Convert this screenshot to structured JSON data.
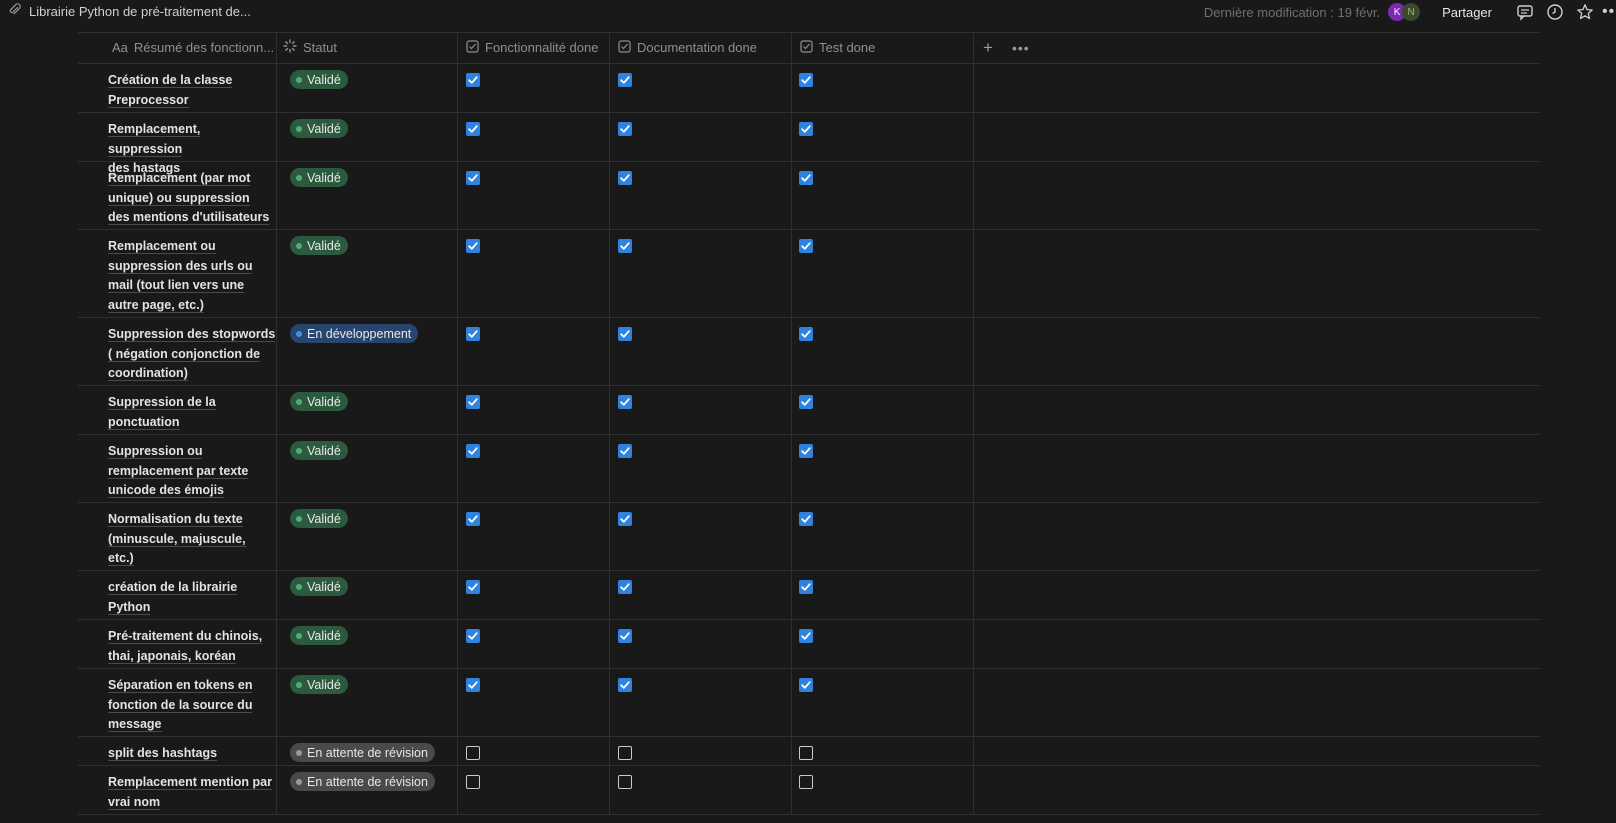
{
  "topbar": {
    "page_title": "Librairie Python de pré-traitement de...",
    "last_modified": "Dernière modification : 19 févr.",
    "avatars": [
      "K",
      "N"
    ],
    "share_label": "Partager"
  },
  "table": {
    "columns": [
      {
        "icon": "Aa",
        "label": "Résumé des fonctionn..."
      },
      {
        "label": "Statut"
      },
      {
        "label": "Fonctionnalité done"
      },
      {
        "label": "Documentation done"
      },
      {
        "label": "Test done"
      }
    ],
    "rows": [
      {
        "name": [
          "Création de la classe",
          "Preprocessor"
        ],
        "status": "Validé",
        "status_color": "green",
        "func": true,
        "doc": true,
        "test": true
      },
      {
        "name": [
          "Remplacement, suppression",
          "des hastags"
        ],
        "status": "Validé",
        "status_color": "green",
        "func": true,
        "doc": true,
        "test": true
      },
      {
        "name": [
          "Remplacement (par mot",
          "unique) ou  suppression",
          "des mentions d'utilisateurs"
        ],
        "status": "Validé",
        "status_color": "green",
        "func": true,
        "doc": true,
        "test": true
      },
      {
        "name": [
          "Remplacement ou",
          "suppression des urls ou",
          "mail (tout lien vers une",
          "autre page, etc.)"
        ],
        "status": "Validé",
        "status_color": "green",
        "func": true,
        "doc": true,
        "test": true
      },
      {
        "name": [
          "Suppression des stopwords",
          "( négation conjonction de",
          "coordination)"
        ],
        "status": "En développement",
        "status_color": "blue",
        "func": true,
        "doc": true,
        "test": true
      },
      {
        "name": [
          "Suppression de la",
          "ponctuation"
        ],
        "status": "Validé",
        "status_color": "green",
        "func": true,
        "doc": true,
        "test": true
      },
      {
        "name": [
          "Suppression ou",
          "remplacement par texte",
          "unicode des émojis"
        ],
        "status": "Validé",
        "status_color": "green",
        "func": true,
        "doc": true,
        "test": true
      },
      {
        "name": [
          "Normalisation du texte",
          "(minuscule, majuscule,",
          "etc.)"
        ],
        "status": "Validé",
        "status_color": "green",
        "func": true,
        "doc": true,
        "test": true
      },
      {
        "name": [
          "création de la librairie",
          "Python"
        ],
        "status": "Validé",
        "status_color": "green",
        "func": true,
        "doc": true,
        "test": true
      },
      {
        "name": [
          "Pré-traitement du chinois,",
          "thai, japonais, koréan"
        ],
        "status": "Validé",
        "status_color": "green",
        "func": true,
        "doc": true,
        "test": true
      },
      {
        "name": [
          "Séparation en tokens en",
          "fonction de la source du",
          "message"
        ],
        "status": "Validé",
        "status_color": "green",
        "func": true,
        "doc": true,
        "test": true
      },
      {
        "name": [
          "split des hashtags"
        ],
        "status": "En attente de révision",
        "status_color": "gray",
        "func": false,
        "doc": false,
        "test": false
      },
      {
        "name": [
          "Remplacement mention par",
          "vrai nom"
        ],
        "status": "En attente de révision",
        "status_color": "gray",
        "func": false,
        "doc": false,
        "test": false
      }
    ]
  }
}
